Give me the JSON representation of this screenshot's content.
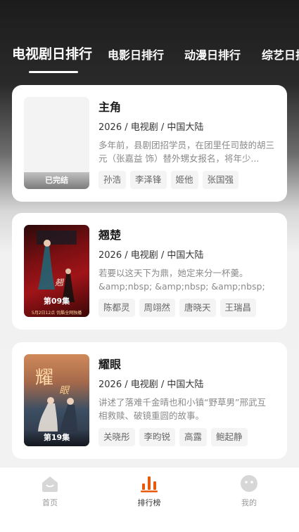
{
  "tabs": [
    {
      "label": "电视剧日排行",
      "active": true
    },
    {
      "label": "电影日排行"
    },
    {
      "label": "动漫日排行"
    },
    {
      "label": "综艺日排"
    }
  ],
  "items": [
    {
      "title": "主角",
      "meta": "2026 / 电视剧 / 中国大陆",
      "desc": "多年前，县剧团招学员，在团里任司鼓的胡三元（张嘉益 饰）替外甥女报名，将年少...",
      "poster_label": "已完结",
      "tags": [
        "孙浩",
        "李泽锋",
        "姬他",
        "张国强"
      ]
    },
    {
      "title": "翘楚",
      "meta": "2026 / 电视剧 / 中国大陆",
      "desc": "若要以这天下为鼎，她定来分一杯羹。&amp;nbsp; &amp;nbsp; &amp;nbsp; ...",
      "poster_label": "第09集",
      "poster_sub": "5月2日12点 优酷全网独播",
      "tags": [
        "陈都灵",
        "周翊然",
        "唐晓天",
        "王瑞昌"
      ]
    },
    {
      "title": "耀眼",
      "meta": "2026 / 电视剧 / 中国大陆",
      "desc": "讲述了落难千金晴也和小镇“野草男”邢武互相救赎、破镜重圆的故事。",
      "poster_label": "第19集",
      "tags": [
        "关晓彤",
        "李昀锐",
        "高露",
        "鲍起静"
      ]
    }
  ],
  "nav": {
    "home": "首页",
    "ranking": "排行榜",
    "mine": "我的"
  },
  "colors": {
    "accent": "#e8590c"
  }
}
